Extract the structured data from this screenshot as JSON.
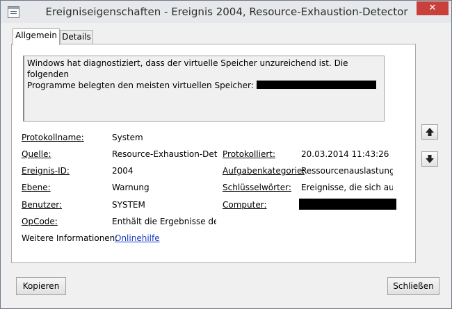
{
  "window": {
    "title": "Ereigniseigenschaften - Ereignis 2004, Resource-Exhaustion-Detector",
    "close_glyph": "✕"
  },
  "tabs": [
    {
      "label": "Allgemein",
      "active": true
    },
    {
      "label": "Details",
      "active": false
    }
  ],
  "description": {
    "line1": "Windows hat diagnostiziert, dass der virtuelle Speicher unzureichend ist. Die folgenden",
    "line2": "Programme belegten den meisten virtuellen Speicher:"
  },
  "fields": {
    "protokollname": {
      "label": "Protokollname:",
      "value": "System"
    },
    "quelle": {
      "label": "Quelle:",
      "value": "Resource-Exhaustion-Detect"
    },
    "ereignis_id": {
      "label": "Ereignis-ID:",
      "value": "2004"
    },
    "ebene": {
      "label": "Ebene:",
      "value": "Warnung"
    },
    "benutzer": {
      "label": "Benutzer:",
      "value": "SYSTEM"
    },
    "opcode": {
      "label": "OpCode:",
      "value": "Enthält die Ergebnisse der Di"
    },
    "weitere_info": {
      "label": "Weitere Informationen:",
      "link": "Onlinehilfe"
    },
    "protokolliert": {
      "label": "Protokolliert:",
      "value": "20.03.2014 11:43:26"
    },
    "aufgabenkategorie": {
      "label": "Aufgabenkategorie:",
      "value": "Ressourcenauslastungsd"
    },
    "schluesselwoerter": {
      "label": "Schlüsselwörter:",
      "value": "Ereignisse, die sich auf d"
    },
    "computer": {
      "label": "Computer:"
    }
  },
  "buttons": {
    "copy": "Kopieren",
    "close": "Schließen"
  },
  "icons": {
    "window": "event-properties-icon",
    "up": "arrow-up-icon",
    "down": "arrow-down-icon"
  }
}
